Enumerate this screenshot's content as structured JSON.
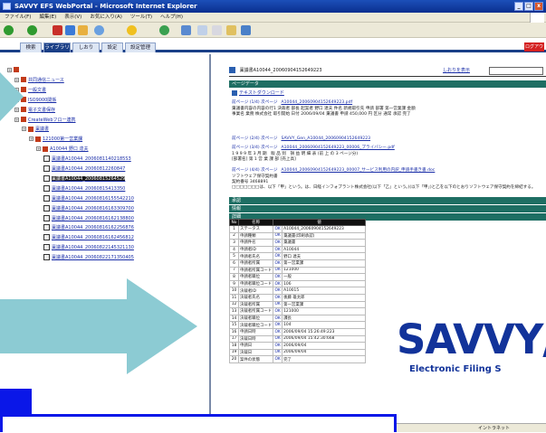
{
  "window": {
    "title": "SAVVY EFS WebPortal - Microsoft Internet Explorer"
  },
  "menu": [
    "ファイル(F)",
    "編集(E)",
    "表示(V)",
    "お気に入り(A)",
    "ツール(T)",
    "ヘルプ(H)"
  ],
  "tabs": [
    {
      "label": "検索",
      "active": false
    },
    {
      "label": "ライブラリ",
      "active": true
    },
    {
      "label": "しおり",
      "active": false
    },
    {
      "label": "設定",
      "active": false
    },
    {
      "label": "設定管理",
      "active": false
    }
  ],
  "logout_label": "ログアウト",
  "tree": [
    {
      "level": 0,
      "label": "",
      "type": "root"
    },
    {
      "level": 1,
      "label": "共同通信ニュース",
      "type": "folder"
    },
    {
      "level": 1,
      "label": "一般文書",
      "type": "folder"
    },
    {
      "level": 1,
      "label": "ISO9000関係",
      "type": "folder"
    },
    {
      "level": 1,
      "label": "電子文書保存",
      "type": "folder"
    },
    {
      "level": 1,
      "label": "CreateWebフロー連携",
      "type": "folder"
    },
    {
      "level": 2,
      "label": "稟議書",
      "type": "folder"
    },
    {
      "level": 3,
      "label": "121000第一営業課",
      "type": "folder"
    },
    {
      "level": 4,
      "label": "A10044 野口 達夫",
      "type": "folder"
    },
    {
      "level": 5,
      "label": "稟議書A10044_20060811402185S3",
      "type": "doc"
    },
    {
      "level": 5,
      "label": "稟議書A10044_20060812260847",
      "type": "doc"
    },
    {
      "level": 5,
      "label": "稟議書A10044_20060815264529",
      "type": "doc",
      "selected": true
    },
    {
      "level": 5,
      "label": "稟議書A10044_20060815413350",
      "type": "doc"
    },
    {
      "level": 5,
      "label": "稟議書A10044_20060816155542210",
      "type": "doc"
    },
    {
      "level": 5,
      "label": "稟議書A10044_20060816163309700",
      "type": "doc"
    },
    {
      "level": 5,
      "label": "稟議書A10044_20060816162138800",
      "type": "doc"
    },
    {
      "level": 5,
      "label": "稟議書A10044_20060816162256876",
      "type": "doc"
    },
    {
      "level": 5,
      "label": "稟議書A10044_20060816162456812",
      "type": "doc"
    },
    {
      "level": 5,
      "label": "稟議書A10044_20060822145321130",
      "type": "doc"
    },
    {
      "level": 5,
      "label": "稟議書A10044_20060822171350405",
      "type": "doc"
    }
  ],
  "doc": {
    "title": "稟議書A10044_20060904152649223",
    "show_link": "しおりを表示",
    "search_placeholder": ""
  },
  "sections": {
    "page_data": "ページデータ",
    "approval": "承認",
    "info": "情報",
    "detail": "詳細"
  },
  "download_label": "テキストダウンロード",
  "pages": [
    {
      "nav": "前ページ (1/4) 次ページ",
      "file": "A10044_20060904152649223.pdf",
      "lines": [
        "稟議書内容の内容の行1 決裁者 部長 起案者 野口 達夫 件名 新規取引先 申請 部署 第一営業課 金額",
        "事業名 業務 株式会社 取引開始 日付 2006/09/04 稟議書 申請 450,000 円 区分 通常 承認 完了"
      ]
    },
    {
      "nav": "前ページ (2/4) 次ページ",
      "file": "SAVVY_Gen_A10044_20060904152649223",
      "lines": []
    },
    {
      "nav": "前ページ (3/4) 次ページ",
      "file": "A10044_20060904152649223_00006_プライバシー.pdf",
      "lines": [
        "1 9 9 9 年 3 月 期　販 品 別　損 益 明 細 表 (前 上 の 3 ページ分)",
        "[部署名] 第 1 営 業 課 部 [売上高]"
      ]
    },
    {
      "nav": "前ページ (4/4) 次ページ",
      "file": "A10044_20060904152649223_00007_サービス利用の内訳_申請手書き書.doc",
      "lines": [
        "ソフトウェア保守契約書",
        "契約番号 3468891",
        "□□□□□□□は、以下「甲」という。は、日経インフォプラント株式会社(以下「乙」という。)(以下「甲」)と乙を以下のとおりソフトウェア保守契約を締結する。"
      ]
    }
  ],
  "meta_headers": [
    "No",
    "名称",
    "値"
  ],
  "meta_rows": [
    [
      "1",
      "ステータス",
      "OK",
      "A10044_20060904152649223"
    ],
    [
      "2",
      "申請種類",
      "OK",
      "稟議書(印刷承認)"
    ],
    [
      "3",
      "申請件名",
      "OK",
      "稟議書"
    ],
    [
      "4",
      "申請者ID",
      "OK",
      "A10044"
    ],
    [
      "5",
      "申請者氏名",
      "OK",
      "野口 達夫"
    ],
    [
      "6",
      "申請者所属",
      "OK",
      "第一営業課"
    ],
    [
      "7",
      "申請者所属コード",
      "OK",
      "121000"
    ],
    [
      "8",
      "申請者職位",
      "OK",
      "一般"
    ],
    [
      "9",
      "申請者職位コード",
      "OK",
      "106"
    ],
    [
      "10",
      "決裁者ID",
      "OK",
      "A10015"
    ],
    [
      "11",
      "決裁者氏名",
      "OK",
      "後藤 雄太郎"
    ],
    [
      "12",
      "決裁者所属",
      "OK",
      "第一営業課"
    ],
    [
      "13",
      "決裁者所属コード",
      "OK",
      "121000"
    ],
    [
      "14",
      "決裁者職位",
      "OK",
      "課長"
    ],
    [
      "15",
      "決裁者職位コード",
      "OK",
      "104"
    ],
    [
      "16",
      "申請日時",
      "OK",
      "2006/09/04 15:26:49:223"
    ],
    [
      "17",
      "決裁日時",
      "OK",
      "2006/09/04 15:42:30:668"
    ],
    [
      "18",
      "申請日",
      "OK",
      "2006/09/04"
    ],
    [
      "19",
      "決裁日",
      "OK",
      "2006/09/04"
    ],
    [
      "20",
      "案件の状態",
      "OK",
      "完了"
    ]
  ],
  "brand": {
    "name": "SAVVY/",
    "tagline": "Electronic Filing S"
  },
  "status": {
    "zone": "イントラネット"
  },
  "colors": {
    "accent": "#1a3f87",
    "section": "#1e6e63",
    "brand": "#12339a",
    "highlight": "#0a17e8",
    "arrow": "#8ccbd3"
  }
}
